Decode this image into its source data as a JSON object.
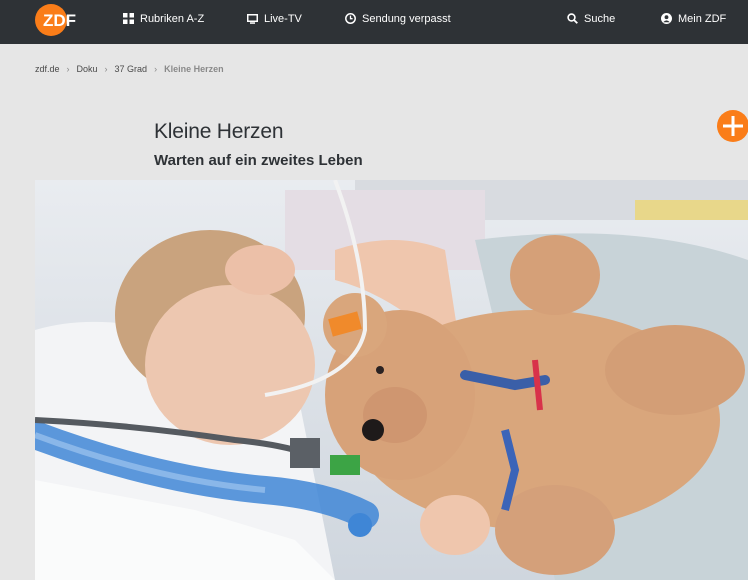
{
  "header": {
    "logo_text": "ZDF",
    "nav": {
      "rubriken": "Rubriken A-Z",
      "livetv": "Live-TV",
      "verpasst": "Sendung verpasst",
      "suche": "Suche",
      "mein": "Mein ZDF"
    }
  },
  "breadcrumb": {
    "home": "zdf.de",
    "level1": "Doku",
    "level2": "37 Grad",
    "current": "Kleine Herzen",
    "separator": "›"
  },
  "content": {
    "title": "Kleine Herzen",
    "subtitle": "Warten auf ein zweites Leben"
  },
  "colors": {
    "brand_orange": "#fa7d19",
    "topbar": "#2e3236",
    "page_bg": "#e6e6e6"
  }
}
